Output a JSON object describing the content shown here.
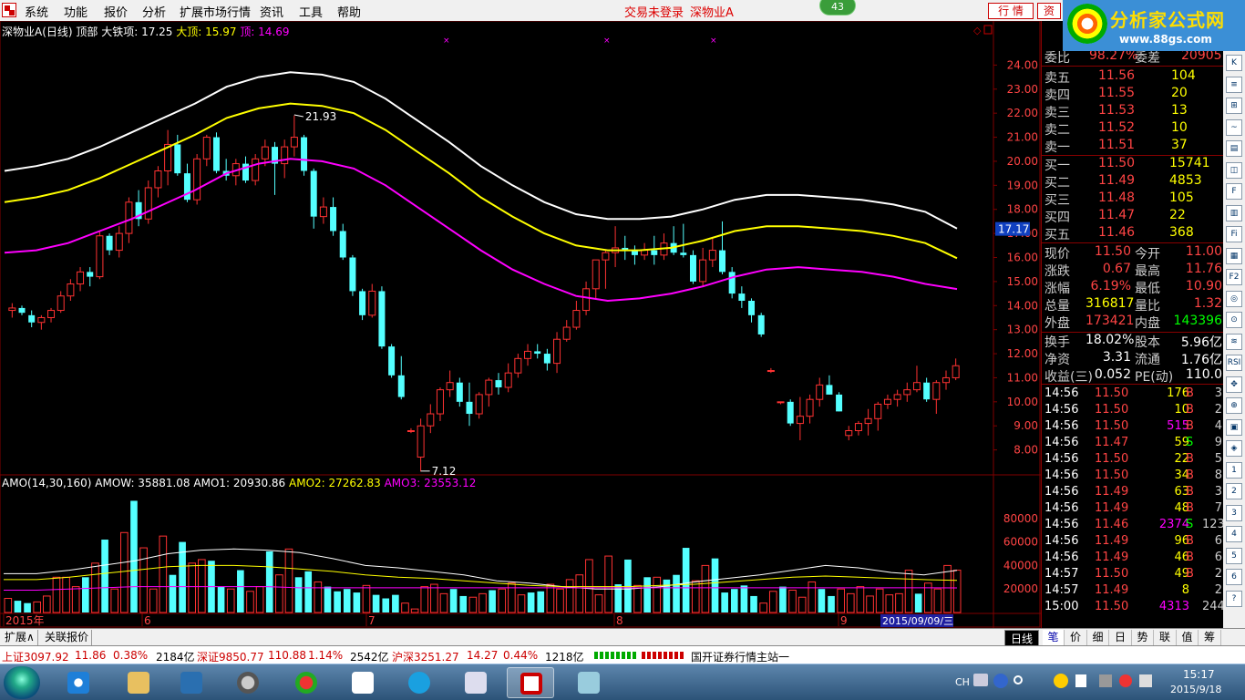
{
  "menu": {
    "items": [
      "系统",
      "功能",
      "报价",
      "分析",
      "扩展市场行情",
      "资讯",
      "工具",
      "帮助"
    ],
    "trade_status": "交易未登录",
    "stock_name": "深物业A",
    "badge": "43",
    "tab_quote": "行 情",
    "tab_info": "资"
  },
  "brand": {
    "name": "分析家公式网",
    "url": "www.88gs.com"
  },
  "chart": {
    "main_legend": {
      "title": "深物业A(日线) 顶部",
      "s1": "大铁项: 17.25",
      "s2": "大顶: 15.97",
      "s3": "顶: 14.69"
    },
    "price_axis": [
      "24.00",
      "23.00",
      "22.00",
      "21.00",
      "20.00",
      "19.00",
      "18.00",
      "17.00",
      "16.00",
      "15.00",
      "14.00",
      "13.00",
      "12.00",
      "11.00",
      "10.00",
      "9.00",
      "8.00"
    ],
    "current_price_tag": "17.17",
    "high_annotation": "21.93",
    "low_annotation": "7.12",
    "vol_legend": {
      "name": "AMO(14,30,160)",
      "amow": "AMOW: 35881.08",
      "amo1": "AMO1: 20930.86",
      "amo2": "AMO2: 27262.83",
      "amo3": "AMO3: 23553.12"
    },
    "vol_axis": [
      "80000",
      "60000",
      "40000",
      "20000"
    ],
    "date_labels": [
      "2015年",
      "6",
      "7",
      "8",
      "9"
    ],
    "cursor_date": "2015/09/09/三",
    "period": "日线",
    "colors": {
      "up": "#ff3232",
      "down": "#54ffff",
      "white": "#ffffff",
      "yellow": "#ffff00",
      "magenta": "#ff00ff",
      "grid": "#800000"
    }
  },
  "chart_data": [
    {
      "type": "candlestick",
      "title": "深物业A(日线) 顶部",
      "x": "trading days May–Sep 2015",
      "ylim": [
        7,
        25
      ],
      "ohlc": [
        [
          13.8,
          14.1,
          13.5,
          13.9
        ],
        [
          13.9,
          14.0,
          13.6,
          13.7
        ],
        [
          13.6,
          13.8,
          13.1,
          13.3
        ],
        [
          13.3,
          13.6,
          13.0,
          13.5
        ],
        [
          13.5,
          13.9,
          13.3,
          13.8
        ],
        [
          13.8,
          14.6,
          13.7,
          14.4
        ],
        [
          14.4,
          15.1,
          14.2,
          14.9
        ],
        [
          14.9,
          15.6,
          14.6,
          15.4
        ],
        [
          15.4,
          15.6,
          14.8,
          15.2
        ],
        [
          15.2,
          17.1,
          15.1,
          16.9
        ],
        [
          16.9,
          17.0,
          16.1,
          16.3
        ],
        [
          16.3,
          17.3,
          16.0,
          17.0
        ],
        [
          17.0,
          18.5,
          16.6,
          18.3
        ],
        [
          18.3,
          18.8,
          17.3,
          17.6
        ],
        [
          17.6,
          19.2,
          17.4,
          18.9
        ],
        [
          18.9,
          19.8,
          18.5,
          19.6
        ],
        [
          19.6,
          21.3,
          19.0,
          20.7
        ],
        [
          20.7,
          21.1,
          19.4,
          19.5
        ],
        [
          19.5,
          19.9,
          18.3,
          18.4
        ],
        [
          18.4,
          20.3,
          18.2,
          20.1
        ],
        [
          20.1,
          21.1,
          19.8,
          21.0
        ],
        [
          21.0,
          21.2,
          19.5,
          19.6
        ],
        [
          19.6,
          20.1,
          19.2,
          19.4
        ],
        [
          19.4,
          20.1,
          19.0,
          19.9
        ],
        [
          19.9,
          20.2,
          19.1,
          19.2
        ],
        [
          19.2,
          20.3,
          19.0,
          20.1
        ],
        [
          20.1,
          20.9,
          19.8,
          20.6
        ],
        [
          20.6,
          20.8,
          18.6,
          19.9
        ],
        [
          19.9,
          20.9,
          19.3,
          20.6
        ],
        [
          20.6,
          21.9,
          20.2,
          21.0
        ],
        [
          21.0,
          21.1,
          19.4,
          19.6
        ],
        [
          19.6,
          19.7,
          17.2,
          17.7
        ],
        [
          17.7,
          18.5,
          17.4,
          18.1
        ],
        [
          18.1,
          18.5,
          16.9,
          17.1
        ],
        [
          17.1,
          17.4,
          15.9,
          16.0
        ],
        [
          16.0,
          16.1,
          14.4,
          14.6
        ],
        [
          14.6,
          14.7,
          13.4,
          13.6
        ],
        [
          13.6,
          14.9,
          13.5,
          14.6
        ],
        [
          14.6,
          14.8,
          12.2,
          12.3
        ],
        [
          12.3,
          12.4,
          11.0,
          11.1
        ],
        [
          11.1,
          11.9,
          10.1,
          10.2
        ],
        [
          8.8,
          8.9,
          8.7,
          8.8
        ],
        [
          7.7,
          9.3,
          7.1,
          9.0
        ],
        [
          9.0,
          9.9,
          8.7,
          9.5
        ],
        [
          9.5,
          10.6,
          9.2,
          10.5
        ],
        [
          10.5,
          11.3,
          10.2,
          10.8
        ],
        [
          10.8,
          11.0,
          9.8,
          10.0
        ],
        [
          10.0,
          10.8,
          9.0,
          9.5
        ],
        [
          9.5,
          10.4,
          9.3,
          10.3
        ],
        [
          10.3,
          11.0,
          9.8,
          10.9
        ],
        [
          10.9,
          11.2,
          10.3,
          10.6
        ],
        [
          10.6,
          11.6,
          10.4,
          11.2
        ],
        [
          11.2,
          12.0,
          11.0,
          11.8
        ],
        [
          11.8,
          12.4,
          11.5,
          12.1
        ],
        [
          12.1,
          12.4,
          11.8,
          12.0
        ],
        [
          12.0,
          12.2,
          11.3,
          11.6
        ],
        [
          11.6,
          12.9,
          11.2,
          12.6
        ],
        [
          12.6,
          13.4,
          12.5,
          13.1
        ],
        [
          13.1,
          14.2,
          13.0,
          13.8
        ],
        [
          13.8,
          15.0,
          13.6,
          14.7
        ],
        [
          14.7,
          15.1,
          14.3,
          15.9
        ],
        [
          15.9,
          16.3,
          14.7,
          16.2
        ],
        [
          16.2,
          17.3,
          15.6,
          16.4
        ],
        [
          16.4,
          16.9,
          15.9,
          16.3
        ],
        [
          16.3,
          16.5,
          15.7,
          16.1
        ],
        [
          16.1,
          16.6,
          15.9,
          16.3
        ],
        [
          16.3,
          16.9,
          15.7,
          16.1
        ],
        [
          16.1,
          17.0,
          15.9,
          16.6
        ],
        [
          16.6,
          17.3,
          16.1,
          16.2
        ],
        [
          16.2,
          17.4,
          16.0,
          16.1
        ],
        [
          16.1,
          16.3,
          14.9,
          15.0
        ],
        [
          15.0,
          16.4,
          14.8,
          15.9
        ],
        [
          15.9,
          16.8,
          15.6,
          16.3
        ],
        [
          16.3,
          17.5,
          15.3,
          15.4
        ],
        [
          15.4,
          15.6,
          14.3,
          14.5
        ],
        [
          14.5,
          14.8,
          13.9,
          14.2
        ],
        [
          14.2,
          14.3,
          13.3,
          13.6
        ],
        [
          13.6,
          13.7,
          12.7,
          12.8
        ],
        [
          11.3,
          11.4,
          11.2,
          11.3
        ],
        [
          10.0,
          10.0,
          9.9,
          10.0
        ],
        [
          10.0,
          10.1,
          9.0,
          9.1
        ],
        [
          9.1,
          10.2,
          8.4,
          9.4
        ],
        [
          9.4,
          10.3,
          9.1,
          10.1
        ],
        [
          10.1,
          11.0,
          9.8,
          10.7
        ],
        [
          10.7,
          11.1,
          10.3,
          10.3
        ],
        [
          10.3,
          10.4,
          9.6,
          9.6
        ],
        [
          8.6,
          9.0,
          8.4,
          8.8
        ],
        [
          8.8,
          9.2,
          8.6,
          9.1
        ],
        [
          9.1,
          9.7,
          8.6,
          9.3
        ],
        [
          9.3,
          10.0,
          8.8,
          9.9
        ],
        [
          9.9,
          10.3,
          9.7,
          10.1
        ],
        [
          10.1,
          10.5,
          9.8,
          10.3
        ],
        [
          10.3,
          10.8,
          10.0,
          10.5
        ],
        [
          10.5,
          11.5,
          10.4,
          10.8
        ],
        [
          10.8,
          11.0,
          10.0,
          10.1
        ],
        [
          10.1,
          10.9,
          9.5,
          10.8
        ],
        [
          10.8,
          11.3,
          10.5,
          11.0
        ],
        [
          11.0,
          11.8,
          10.9,
          11.5
        ]
      ],
      "bands": {
        "white": [
          19.6,
          19.8,
          20.1,
          20.6,
          21.2,
          21.8,
          22.4,
          23.1,
          23.5,
          23.7,
          23.6,
          23.3,
          22.6,
          21.7,
          20.8,
          19.8,
          19.0,
          18.3,
          17.8,
          17.6,
          17.6,
          17.7,
          18.0,
          18.4,
          18.6,
          18.6,
          18.5,
          18.4,
          18.2,
          17.9,
          17.2
        ],
        "yellow": [
          18.3,
          18.5,
          18.8,
          19.3,
          19.9,
          20.5,
          21.1,
          21.8,
          22.2,
          22.4,
          22.3,
          22.0,
          21.3,
          20.4,
          19.5,
          18.5,
          17.7,
          17.0,
          16.5,
          16.3,
          16.3,
          16.4,
          16.7,
          17.1,
          17.3,
          17.3,
          17.2,
          17.1,
          16.9,
          16.6,
          15.97
        ],
        "magenta": [
          16.2,
          16.3,
          16.6,
          17.1,
          17.6,
          18.2,
          18.8,
          19.5,
          19.9,
          20.1,
          20.0,
          19.7,
          19.0,
          18.1,
          17.2,
          16.3,
          15.5,
          14.9,
          14.4,
          14.2,
          14.3,
          14.5,
          14.8,
          15.2,
          15.5,
          15.6,
          15.5,
          15.4,
          15.2,
          14.9,
          14.69
        ]
      }
    },
    {
      "type": "bar",
      "title": "AMO(14,30,160)",
      "ylim": [
        0,
        100000
      ],
      "values": [
        12000,
        10000,
        8000,
        9000,
        14000,
        30000,
        30000,
        22000,
        30000,
        42000,
        62000,
        20000,
        68000,
        95000,
        55000,
        20000,
        65000,
        32000,
        60000,
        42000,
        45000,
        44000,
        22000,
        20000,
        36000,
        18000,
        22000,
        52000,
        32000,
        54000,
        30000,
        35000,
        26000,
        22000,
        18000,
        20000,
        17000,
        23000,
        15000,
        12000,
        15000,
        8000,
        3000,
        22000,
        24000,
        16000,
        20000,
        14000,
        13000,
        16000,
        19000,
        20000,
        25000,
        15000,
        17000,
        18000,
        24000,
        20000,
        28000,
        32000,
        45000,
        15000,
        48000,
        24000,
        45000,
        23000,
        30000,
        30000,
        28000,
        32000,
        55000,
        27000,
        40000,
        46000,
        17000,
        20000,
        23000,
        14000,
        8000,
        18000,
        22000,
        19000,
        13000,
        26000,
        20000,
        14000,
        20000,
        16000,
        22000,
        14000,
        20000,
        15000,
        16000,
        36000,
        16000,
        25000,
        20000,
        40000,
        36000
      ],
      "series": [
        {
          "name": "AMOW",
          "values": [
            33000,
            33000,
            36000,
            40000,
            44000,
            50000,
            53000,
            54000,
            53000,
            51000,
            46000,
            40000,
            38000,
            35000,
            32000,
            27000,
            25000,
            22000,
            20000,
            20000,
            22000,
            26000,
            29000,
            32000,
            36000,
            40000,
            38000,
            34000,
            32000,
            35881
          ]
        },
        {
          "name": "AMO1",
          "values": [
            28000,
            28000,
            30000,
            33000,
            36000,
            39000,
            40000,
            40000,
            39000,
            37000,
            35000,
            32000,
            30000,
            29000,
            27000,
            25000,
            23000,
            22000,
            22000,
            22000,
            23000,
            24000,
            26000,
            28000,
            30000,
            31000,
            30000,
            29000,
            28000,
            27263
          ]
        },
        {
          "name": "AMO2",
          "values": [
            19000,
            19000,
            20000,
            21000,
            22000,
            22000,
            22000,
            22000,
            22000,
            21000,
            21000,
            21000,
            21000,
            21000,
            21000,
            21000,
            21000,
            21000,
            21000,
            21000,
            21000,
            21000,
            21000,
            21000,
            21000,
            21000,
            21000,
            21000,
            21000,
            20931
          ]
        }
      ]
    }
  ],
  "quote": {
    "wb_label": "委比",
    "wb_value": "98.27%",
    "wc_label": "委差",
    "wc_value": "20905",
    "sells": [
      {
        "label": "卖五",
        "price": "11.56",
        "vol": "104"
      },
      {
        "label": "卖四",
        "price": "11.55",
        "vol": "20"
      },
      {
        "label": "卖三",
        "price": "11.53",
        "vol": "13"
      },
      {
        "label": "卖二",
        "price": "11.52",
        "vol": "10"
      },
      {
        "label": "卖一",
        "price": "11.51",
        "vol": "37"
      }
    ],
    "buys": [
      {
        "label": "买一",
        "price": "11.50",
        "vol": "15741"
      },
      {
        "label": "买二",
        "price": "11.49",
        "vol": "4853"
      },
      {
        "label": "买三",
        "price": "11.48",
        "vol": "105"
      },
      {
        "label": "买四",
        "price": "11.47",
        "vol": "22"
      },
      {
        "label": "买五",
        "price": "11.46",
        "vol": "368"
      }
    ],
    "stats": [
      {
        "l1": "现价",
        "v1": "11.50",
        "l2": "今开",
        "v2": "11.00"
      },
      {
        "l1": "涨跌",
        "v1": "0.67",
        "l2": "最高",
        "v2": "11.76"
      },
      {
        "l1": "涨幅",
        "v1": "6.19%",
        "l2": "最低",
        "v2": "10.90"
      },
      {
        "l1": "总量",
        "v1": "316817",
        "l2": "量比",
        "v2": "1.32"
      },
      {
        "l1": "外盘",
        "v1": "173421",
        "l2": "内盘",
        "v2": "143396"
      }
    ],
    "fin": [
      {
        "l1": "换手",
        "v1": "18.02%",
        "l2": "股本",
        "v2": "5.96亿"
      },
      {
        "l1": "净资",
        "v1": "3.31",
        "l2": "流通",
        "v2": "1.76亿"
      },
      {
        "l1": "收益(三)",
        "v1": "0.052",
        "l2": "PE(动)",
        "v2": "110.0"
      }
    ],
    "ticks": [
      {
        "t": "14:56",
        "p": "11.50",
        "v": "176",
        "d": "B",
        "n": "3"
      },
      {
        "t": "14:56",
        "p": "11.50",
        "v": "10",
        "d": "B",
        "n": "2"
      },
      {
        "t": "14:56",
        "p": "11.50",
        "v": "515",
        "d": "B",
        "n": "4"
      },
      {
        "t": "14:56",
        "p": "11.47",
        "v": "59",
        "d": "S",
        "n": "9"
      },
      {
        "t": "14:56",
        "p": "11.50",
        "v": "22",
        "d": "B",
        "n": "5"
      },
      {
        "t": "14:56",
        "p": "11.50",
        "v": "34",
        "d": "B",
        "n": "8"
      },
      {
        "t": "14:56",
        "p": "11.49",
        "v": "63",
        "d": "B",
        "n": "3"
      },
      {
        "t": "14:56",
        "p": "11.49",
        "v": "48",
        "d": "B",
        "n": "7"
      },
      {
        "t": "14:56",
        "p": "11.46",
        "v": "2374",
        "d": "S",
        "n": "123"
      },
      {
        "t": "14:56",
        "p": "11.49",
        "v": "96",
        "d": "B",
        "n": "6"
      },
      {
        "t": "14:56",
        "p": "11.49",
        "v": "46",
        "d": "B",
        "n": "6"
      },
      {
        "t": "14:57",
        "p": "11.50",
        "v": "49",
        "d": "B",
        "n": "2"
      },
      {
        "t": "14:57",
        "p": "11.49",
        "v": "8",
        "d": "",
        "n": "2"
      },
      {
        "t": "15:00",
        "p": "11.50",
        "v": "4313",
        "d": "",
        "n": "244"
      }
    ]
  },
  "right_tabs": [
    "笔",
    "价",
    "细",
    "日",
    "势",
    "联",
    "值",
    "筹"
  ],
  "bottom_tabs": [
    "扩展∧",
    "关联报价"
  ],
  "status": {
    "sh": "上证3097.92",
    "sh_chg": "11.86",
    "sh_pct": "0.38%",
    "sh_amt": "2184亿",
    "sz": "深证9850.77",
    "sz_chg": "110.88",
    "sz_pct": "1.14%",
    "sz_amt": "2542亿",
    "hs": "沪深3251.27",
    "hs_chg": "14.27",
    "hs_pct": "0.44%",
    "hs_amt": "1218亿",
    "server": "国开证券行情主站一"
  },
  "taskbar": {
    "ime": "CH",
    "time": "15:17",
    "date": "2015/9/18"
  },
  "side_tools": [
    "K",
    "≡",
    "⊞",
    "~",
    "▤",
    "◫",
    "F",
    "▥",
    "Fi",
    "▦",
    "F2",
    "◎",
    "⊙",
    "≋",
    "RSI",
    "✥",
    "⊕",
    "▣",
    "◈",
    "1",
    "2",
    "3",
    "4",
    "5",
    "6",
    "?"
  ]
}
